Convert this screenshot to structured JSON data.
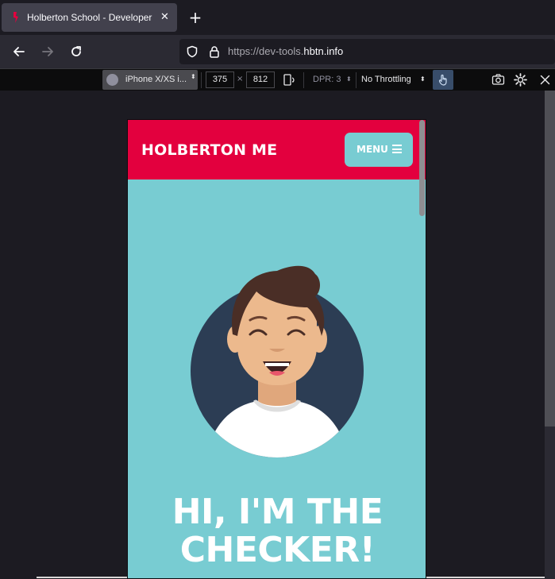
{
  "browser": {
    "tab_title": "Holberton School - Developer",
    "tab_close_glyph": "✕",
    "new_tab_glyph": "+",
    "url_prefix": "https://dev-tools.",
    "url_domain": "hbtn.info"
  },
  "rdm": {
    "device": "iPhone X/XS i...",
    "width": "375",
    "times": "×",
    "height": "812",
    "dpr": "DPR: 3",
    "throttling": "No Throttling",
    "dpr_arrow": "⬍",
    "throttle_arrow": "⬍",
    "device_arrow": "⬍"
  },
  "site": {
    "brand": "HOLBERTON ME",
    "menu_label": "MENU",
    "hero_line1": "HI, I'M THE",
    "hero_line2": "CHECKER!"
  },
  "colors": {
    "header_red": "#e3003e",
    "page_teal": "#78ccd2",
    "avatar_circle": "#2c3d54"
  },
  "icons": [
    "holberton-favicon",
    "close-icon",
    "plus-icon",
    "back-arrow-icon",
    "forward-arrow-icon",
    "reload-icon",
    "shield-icon",
    "lock-icon",
    "rotate-icon",
    "touch-icon",
    "screenshot-icon",
    "settings-icon",
    "close-rdm-icon",
    "hamburger-icon"
  ]
}
